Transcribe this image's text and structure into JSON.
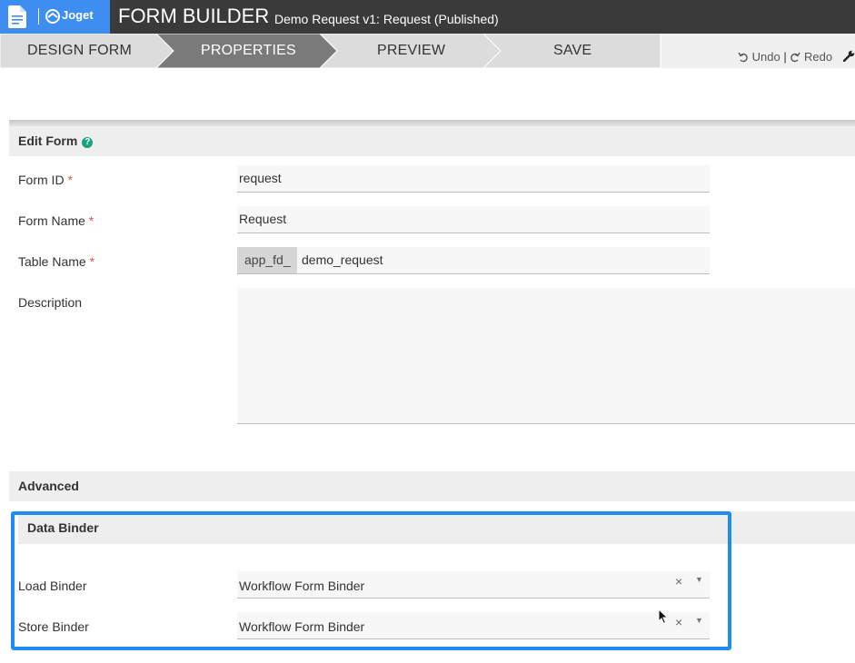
{
  "header": {
    "logo_text": "Joget",
    "title": "FORM BUILDER",
    "subtitle": "Demo Request v1: Request (Published)"
  },
  "steps": [
    {
      "label": "DESIGN FORM",
      "active": false
    },
    {
      "label": "PROPERTIES",
      "active": true
    },
    {
      "label": "PREVIEW",
      "active": false
    },
    {
      "label": "SAVE",
      "active": false
    }
  ],
  "toolbar": {
    "undo_label": "Undo",
    "separator": "|",
    "redo_label": "Redo"
  },
  "edit_form": {
    "title": "Edit Form",
    "help_glyph": "?",
    "required_mark": "*",
    "fields": {
      "form_id": {
        "label": "Form ID",
        "value": "request"
      },
      "form_name": {
        "label": "Form Name",
        "value": "Request"
      },
      "table_name": {
        "label": "Table Name",
        "prefix": "app_fd_",
        "value": "demo_request"
      },
      "description": {
        "label": "Description",
        "value": ""
      }
    }
  },
  "advanced": {
    "title": "Advanced",
    "data_binder": {
      "title": "Data Binder",
      "clear_glyph": "×",
      "caret_glyph": "▼",
      "load_binder": {
        "label": "Load Binder",
        "value": "Workflow Form Binder"
      },
      "store_binder": {
        "label": "Store Binder",
        "value": "Workflow Form Binder"
      }
    }
  },
  "colors": {
    "accent": "#3d8ef0",
    "highlight": "#1e8cf0",
    "topbar": "#3a3a3a",
    "active_step": "#7a7a7a",
    "inactive_step": "#dcdcdc",
    "help": "#1aa27c",
    "required": "#d9534f"
  }
}
